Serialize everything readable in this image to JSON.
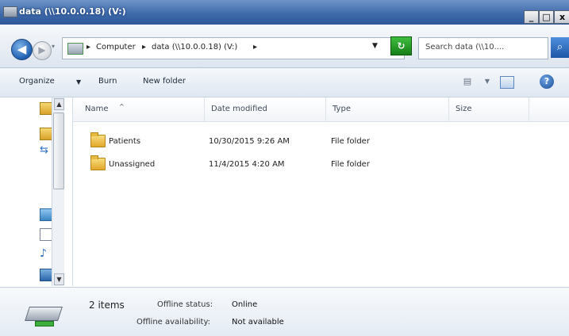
{
  "window": {
    "title": "data (\\\\10.0.0.18) (V:)",
    "buttons": {
      "minimize": "_",
      "maximize": "□",
      "close": "x"
    }
  },
  "address": {
    "crumbs": [
      "Computer",
      "data (\\\\10.0.0.18) (V:)"
    ],
    "search_placeholder": "Search data (\\\\10...."
  },
  "toolbar": {
    "organize": "Organize",
    "burn": "Burn",
    "new_folder": "New folder"
  },
  "columns": [
    "Name",
    "Date modified",
    "Type",
    "Size"
  ],
  "files": [
    {
      "name": "Patients",
      "date": "10/30/2015 9:26 AM",
      "type": "File folder"
    },
    {
      "name": "Unassigned",
      "date": "11/4/2015 4:20 AM",
      "type": "File folder"
    }
  ],
  "details": {
    "count": "2 items",
    "offline_status_label": "Offline status:",
    "offline_status_value": "Online",
    "offline_availability_label": "Offline availability:",
    "offline_availability_value": "Not available"
  }
}
